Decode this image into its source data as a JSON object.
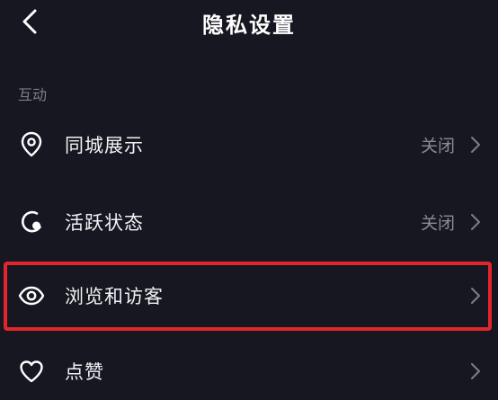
{
  "header": {
    "title": "隐私设置",
    "back_icon": "chevron-left-icon"
  },
  "section": {
    "label": "互动"
  },
  "rows": [
    {
      "label": "同城展示",
      "value": "关闭",
      "icon": "location-pin-icon"
    },
    {
      "label": "活跃状态",
      "value": "关闭",
      "icon": "active-status-icon"
    },
    {
      "label": "浏览和访客",
      "value": "",
      "icon": "eye-icon"
    },
    {
      "label": "点赞",
      "value": "",
      "icon": "heart-icon"
    }
  ],
  "colors": {
    "background": "#161721",
    "text": "#f2f2f4",
    "muted": "#8a8b93",
    "highlight": "#e3262b"
  }
}
